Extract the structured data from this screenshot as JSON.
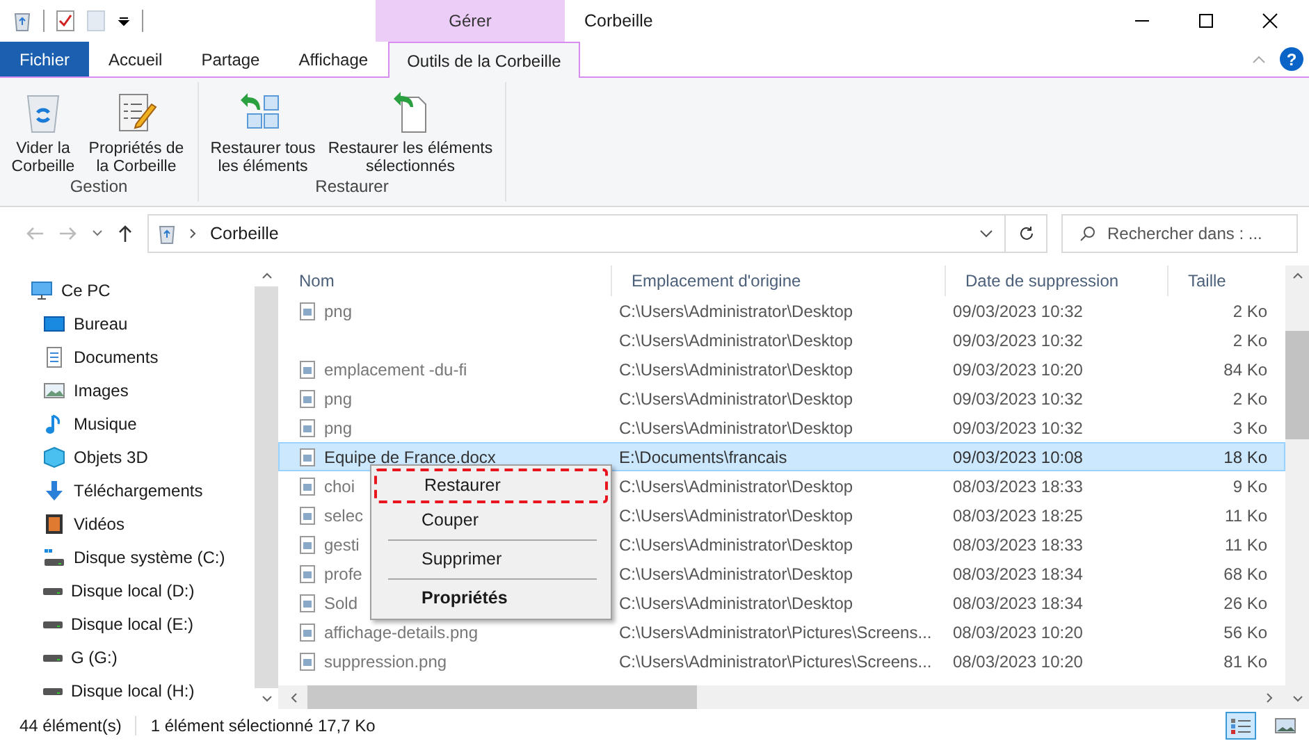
{
  "window": {
    "title": "Corbeille",
    "context_tab": "Gérer"
  },
  "tabs": [
    {
      "label": "Fichier",
      "kind": "file",
      "selected": false
    },
    {
      "label": "Accueil",
      "kind": "tab",
      "selected": false
    },
    {
      "label": "Partage",
      "kind": "tab",
      "selected": false
    },
    {
      "label": "Affichage",
      "kind": "tab",
      "selected": false
    },
    {
      "label": "Outils de la Corbeille",
      "kind": "tab",
      "selected": true
    }
  ],
  "help": "?",
  "ribbon_groups": [
    {
      "label": "Gestion",
      "buttons": [
        {
          "label": "Vider la Corbeille"
        },
        {
          "label": "Propriétés de la Corbeille"
        }
      ]
    },
    {
      "label": "Restaurer",
      "buttons": [
        {
          "label": "Restaurer tous les éléments"
        },
        {
          "label": "Restaurer les éléments sélectionnés"
        }
      ]
    }
  ],
  "address": {
    "path": "Corbeille"
  },
  "search": {
    "placeholder": "Rechercher dans : ..."
  },
  "sidebar": {
    "items": [
      {
        "label": "Ce PC",
        "children": [
          {
            "label": "Bureau"
          },
          {
            "label": "Documents"
          },
          {
            "label": "Images"
          },
          {
            "label": "Musique"
          },
          {
            "label": "Objets 3D"
          },
          {
            "label": "Téléchargements"
          },
          {
            "label": "Vidéos"
          },
          {
            "label": "Disque système (C:)"
          },
          {
            "label": "Disque local (D:)"
          },
          {
            "label": "Disque local (E:)"
          },
          {
            "label": "G (G:)"
          },
          {
            "label": "Disque local (H:)"
          }
        ]
      }
    ]
  },
  "table": {
    "columns": [
      "Nom",
      "Emplacement d'origine",
      "Date de suppression",
      "Taille"
    ],
    "rows": [
      {
        "name": "png",
        "location": "C:\\Users\\Administrator\\Desktop",
        "date": "09/03/2023 10:32",
        "size": "2 Ko",
        "selected": false
      },
      {
        "location": "C:\\Users\\Administrator\\Desktop",
        "date": "09/03/2023 10:32",
        "size": "2 Ko",
        "selected": false
      },
      {
        "name": "emplacement -du-fi",
        "location": "C:\\Users\\Administrator\\Desktop",
        "date": "09/03/2023 10:20",
        "size": "84 Ko",
        "selected": false
      },
      {
        "name": "png",
        "location": "C:\\Users\\Administrator\\Desktop",
        "date": "09/03/2023 10:32",
        "size": "2 Ko",
        "selected": false
      },
      {
        "name": "png",
        "location": "C:\\Users\\Administrator\\Desktop",
        "date": "09/03/2023 10:32",
        "size": "3 Ko",
        "selected": false
      },
      {
        "name": "Equipe de France.docx",
        "location": "E:\\Documents\\francais",
        "date": "09/03/2023 10:08",
        "size": "18 Ko",
        "selected": true
      },
      {
        "name": "choi",
        "location": "C:\\Users\\Administrator\\Desktop",
        "date": "08/03/2023 18:33",
        "size": "9 Ko",
        "selected": false
      },
      {
        "name": "selec",
        "location": "C:\\Users\\Administrator\\Desktop",
        "date": "08/03/2023 18:25",
        "size": "11 Ko",
        "selected": false
      },
      {
        "name": "gesti",
        "location": "C:\\Users\\Administrator\\Desktop",
        "date": "08/03/2023 18:33",
        "size": "11 Ko",
        "selected": false
      },
      {
        "name": "profe",
        "location": "C:\\Users\\Administrator\\Desktop",
        "date": "08/03/2023 18:34",
        "size": "68 Ko",
        "selected": false
      },
      {
        "name": "Sold",
        "location": "C:\\Users\\Administrator\\Desktop",
        "date": "08/03/2023 18:34",
        "size": "26 Ko",
        "selected": false
      },
      {
        "name": "affichage-details.png",
        "location": "C:\\Users\\Administrator\\Pictures\\Screens...",
        "date": "08/03/2023 10:20",
        "size": "56 Ko",
        "selected": false
      },
      {
        "name": "suppression.png",
        "location": "C:\\Users\\Administrator\\Pictures\\Screens...",
        "date": "08/03/2023 10:20",
        "size": "81 Ko",
        "selected": false
      }
    ]
  },
  "context_menu": [
    {
      "kind": "item",
      "label": "Restaurer",
      "highlighted": true,
      "default": false
    },
    {
      "kind": "item",
      "label": "Couper",
      "highlighted": false,
      "default": false
    },
    {
      "kind": "separator"
    },
    {
      "kind": "item",
      "label": "Supprimer",
      "highlighted": false,
      "default": false
    },
    {
      "kind": "separator"
    },
    {
      "kind": "item",
      "label": "Propriétés",
      "highlighted": false,
      "default": true
    }
  ],
  "status_bar": {
    "count": "44 élément(s)",
    "selection": "1 élément sélectionné 17,7 Ko"
  },
  "view_buttons": [
    {
      "kind": "details",
      "selected": true
    },
    {
      "kind": "thumbs",
      "selected": false
    }
  ]
}
